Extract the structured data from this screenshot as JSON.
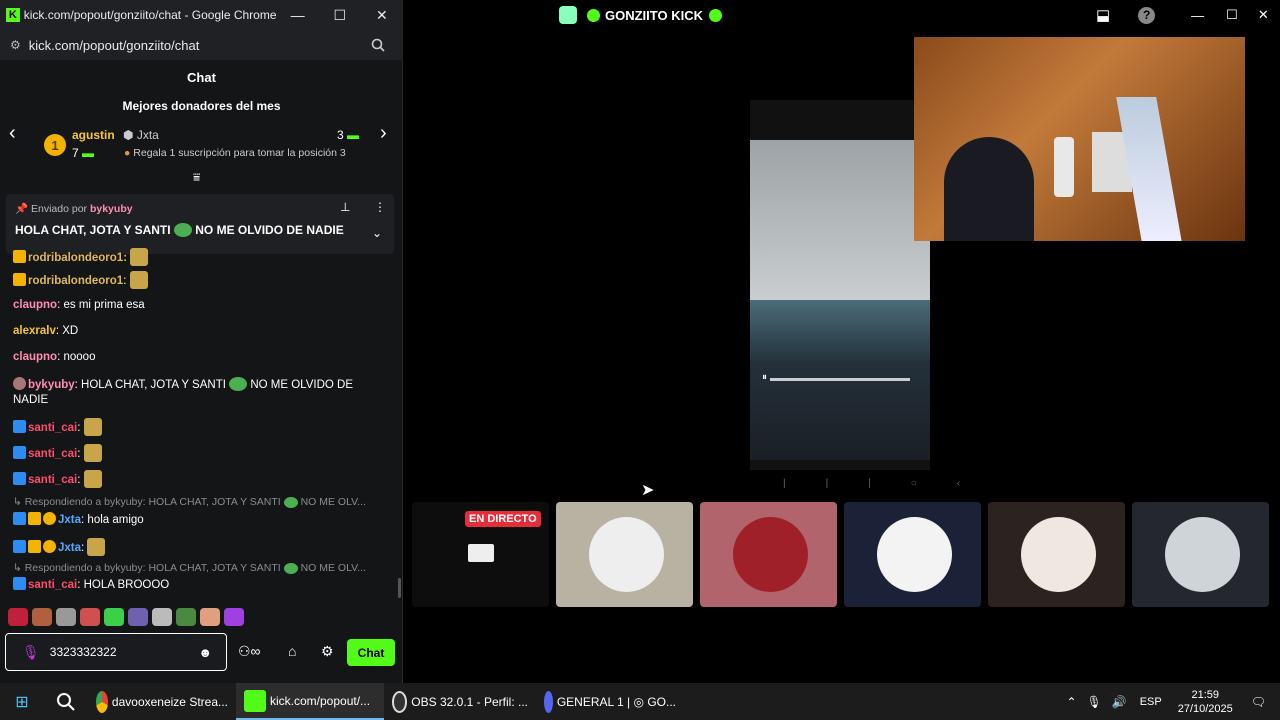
{
  "chrome": {
    "title": "kick.com/popout/gonziito/chat - Google Chrome",
    "url": "kick.com/popout/gonziito/chat",
    "minimize": "—",
    "maximize": "☐",
    "close": "✕"
  },
  "chat": {
    "header": "Chat",
    "donors_title": "Mejores donadores del mes",
    "donor1_rank": "1",
    "donor1_name": "agustin",
    "donor1_count": "7",
    "donor2_name": "Jxta",
    "donor2_count": "3",
    "donor_cta": "Regala 1 suscripción para tomar la posición 3",
    "pinned_sender_prefix": "Enviado por",
    "pinned_sender": "bykyuby",
    "pinned_text_1": "HOLA CHAT, JOTA Y SANTI",
    "pinned_text_2": "NO ME OLVIDO DE NADIE",
    "messages": {
      "m0_user": "rodribalondeoro1:",
      "m1_user": "rodribalondeoro1",
      "m2_user": "claupno",
      "m2_text": ": es mi prima esa",
      "m3_user": "alexralv",
      "m3_text": ": XD",
      "m4_user": "claupno",
      "m4_text": ": noooo",
      "m5_user": "bykyuby",
      "m5_text_1": ": HOLA CHAT, JOTA Y SANTI",
      "m5_text_2": "NO ME OLVIDO DE",
      "m5_text_3": "NADIE",
      "m6_user": "santi_cai",
      "m7_user": "santi_cai",
      "m8_user": "santi_cai",
      "r1_text": "↳ Respondiendo a bykyuby: HOLA CHAT, JOTA Y SANTI",
      "r1_tail": "NO ME OLV...",
      "m9_user": "Jxta",
      "m9_text": ": hola amigo",
      "m10_user": "Jxta",
      "r2_text": "↳ Respondiendo a bykyuby: HOLA CHAT, JOTA Y SANTI",
      "r2_tail": "NO ME OLV...",
      "m11_user": "santi_cai",
      "m11_text": ": HOLA BROOOO"
    },
    "input_value": "3323332322",
    "chat_button": "Chat"
  },
  "obs": {
    "title": "GONZIITO KICK",
    "live_badge": "EN DIRECTO"
  },
  "taskbar": {
    "item1": "davooxeneize Strea...",
    "item2": "kick.com/popout/...",
    "item3": "OBS 32.0.1 - Perfil: ...",
    "item4": "GENERAL 1 | ◎ GO...",
    "lang": "ESP",
    "time": "21:59",
    "date": "27/10/2025"
  },
  "colors": {
    "kick_green": "#53fc18",
    "chat_bg": "#141517"
  }
}
